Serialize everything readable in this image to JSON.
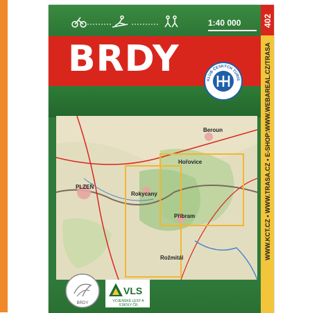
{
  "cover": {
    "title": "BRDY",
    "scale": "1:40 000",
    "map_number": "402",
    "side_text": "WWW.KCT.CZ • WWW.TRASA.CZ • E-SHOP:WWW.WEBAREAL.CZ/TRASA",
    "kct_badge_text": "KLUB ČESKÝCH TURISTŮ",
    "brdy_badge_text": "BRDY",
    "publisher": "VLS",
    "publisher_sub": "VOJENSKÉ LESY A STATKY ČR"
  },
  "map": {
    "labels": [
      "PLZEŇ",
      "Rokycany",
      "Příbram",
      "Beroun",
      "Hořovice",
      "Rožmitál"
    ]
  },
  "colors": {
    "accent_red": "#d9261c",
    "side_yellow": "#f2c53b",
    "cover_green": "#2f7a3b",
    "page_orange": "#f0892a"
  }
}
